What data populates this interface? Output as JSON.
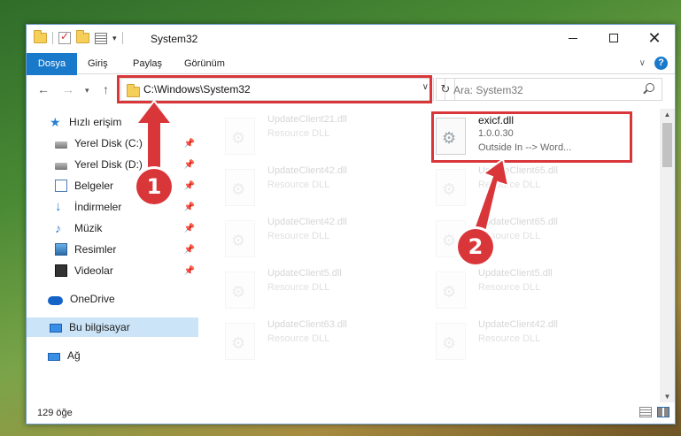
{
  "window": {
    "title": "System32"
  },
  "ribbon": {
    "tabs": [
      "Dosya",
      "Giriş",
      "Paylaş",
      "Görünüm"
    ],
    "help": "?"
  },
  "nav": {
    "address": "C:\\Windows\\System32",
    "search_placeholder": "Ara: System32"
  },
  "sidebar": {
    "items": [
      {
        "label": "Hızlı erişim",
        "icon": "star-icon"
      },
      {
        "label": "Yerel Disk (C:)",
        "icon": "drive-icon",
        "pinned": true
      },
      {
        "label": "Yerel Disk (D:)",
        "icon": "drive-icon",
        "pinned": true
      },
      {
        "label": "Belgeler",
        "icon": "documents-icon",
        "pinned": true
      },
      {
        "label": "İndirmeler",
        "icon": "downloads-icon",
        "pinned": true
      },
      {
        "label": "Müzik",
        "icon": "music-icon",
        "pinned": true
      },
      {
        "label": "Resimler",
        "icon": "pictures-icon",
        "pinned": true
      },
      {
        "label": "Videolar",
        "icon": "videos-icon",
        "pinned": true
      },
      {
        "label": "OneDrive",
        "icon": "onedrive-icon"
      },
      {
        "label": "Bu bilgisayar",
        "icon": "this-pc-icon",
        "selected": true
      },
      {
        "label": "Ağ",
        "icon": "network-icon"
      }
    ]
  },
  "files": {
    "left_column": [
      {
        "name": "UpdateClient21.dll",
        "desc": "Resource DLL"
      },
      {
        "name": "UpdateClient42.dll",
        "desc": "Resource DLL"
      },
      {
        "name": "UpdateClient42.dll",
        "desc": "Resource DLL"
      },
      {
        "name": "UpdateClient5.dll",
        "desc": "Resource DLL"
      },
      {
        "name": "UpdateClient63.dll",
        "desc": "Resource DLL"
      }
    ],
    "selected": {
      "name": "exicf.dll",
      "version": "1.0.0.30",
      "company": "Outside In --> Word..."
    },
    "right_column": [
      {
        "name": "UpdateClient65.dll",
        "desc": "Resource DLL"
      },
      {
        "name": "UpdateClient65.dll",
        "desc": "Resource DLL"
      },
      {
        "name": "UpdateClient5.dll",
        "desc": "Resource DLL"
      },
      {
        "name": "UpdateClient42.dll",
        "desc": "Resource DLL"
      }
    ]
  },
  "status": {
    "count": "129 öğe"
  },
  "callouts": [
    "1",
    "2"
  ],
  "colors": {
    "accent": "#1979ca",
    "highlight": "#d9363a",
    "selection": "#cce4f7"
  }
}
